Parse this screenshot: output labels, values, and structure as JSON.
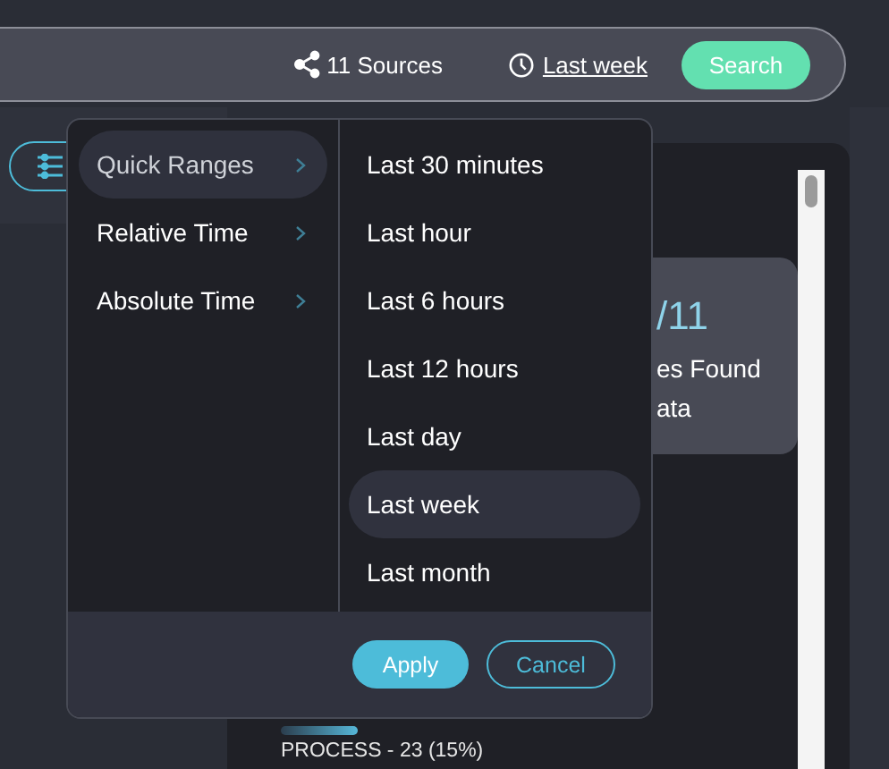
{
  "search_bar": {
    "sources": "11 Sources",
    "time_range": "Last week",
    "search_button": "Search"
  },
  "result_card": {
    "count": "/11",
    "line_1": "es Found",
    "line_2": "ata"
  },
  "process": {
    "label": "PROCESS - 23 (15%)"
  },
  "time_menu": {
    "categories": [
      {
        "label": "Quick Ranges",
        "selected": true
      },
      {
        "label": "Relative Time",
        "selected": false
      },
      {
        "label": "Absolute Time",
        "selected": false
      }
    ],
    "options": [
      {
        "label": "Last 30 minutes",
        "selected": false
      },
      {
        "label": "Last hour",
        "selected": false
      },
      {
        "label": "Last 6 hours",
        "selected": false
      },
      {
        "label": "Last 12 hours",
        "selected": false
      },
      {
        "label": "Last day",
        "selected": false
      },
      {
        "label": "Last week",
        "selected": true
      },
      {
        "label": "Last month",
        "selected": false
      }
    ],
    "buttons": [
      {
        "label": "Apply",
        "kind": "primary"
      },
      {
        "label": "Cancel",
        "kind": "secondary"
      }
    ]
  }
}
